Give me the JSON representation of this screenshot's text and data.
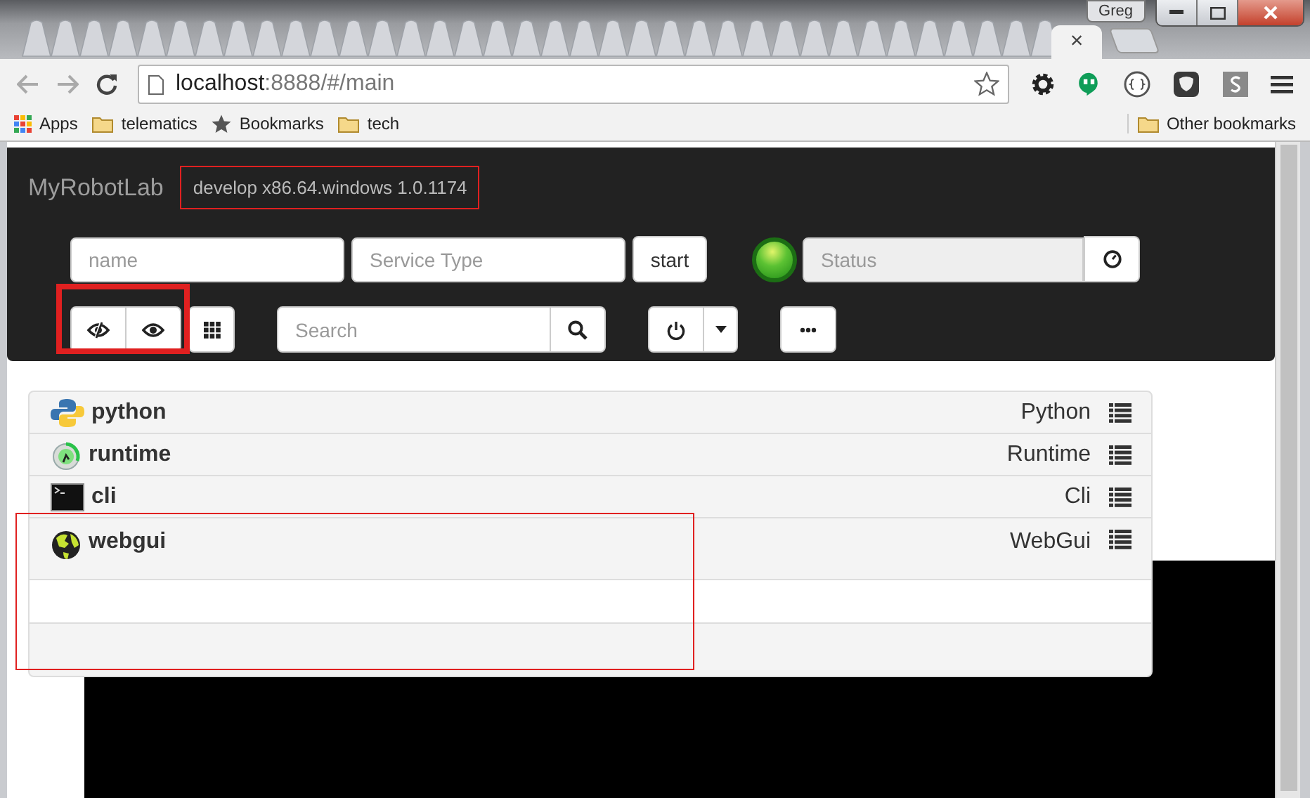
{
  "browser": {
    "user": "Greg",
    "tab_close": "×",
    "url_host": "localhost",
    "url_rest": ":8888/#/main",
    "bookmarks": [
      {
        "label": "Apps",
        "kind": "apps"
      },
      {
        "label": "telematics",
        "kind": "folder"
      },
      {
        "label": "Bookmarks",
        "kind": "star"
      },
      {
        "label": "tech",
        "kind": "folder"
      }
    ],
    "other_bookmarks": "Other bookmarks"
  },
  "navbar": {
    "brand": "MyRobotLab",
    "version": "develop x86.64.windows 1.0.1174",
    "name_placeholder": "name",
    "type_placeholder": "Service Type",
    "start_button": "start",
    "status_placeholder": "Status",
    "search_placeholder": "Search"
  },
  "services": [
    {
      "name": "python",
      "type": "Python",
      "kind": "python"
    },
    {
      "name": "runtime",
      "type": "Runtime",
      "kind": "runtime"
    },
    {
      "name": "cli",
      "type": "Cli",
      "kind": "cli"
    },
    {
      "name": "webgui",
      "type": "WebGui",
      "kind": "webgui"
    }
  ]
}
